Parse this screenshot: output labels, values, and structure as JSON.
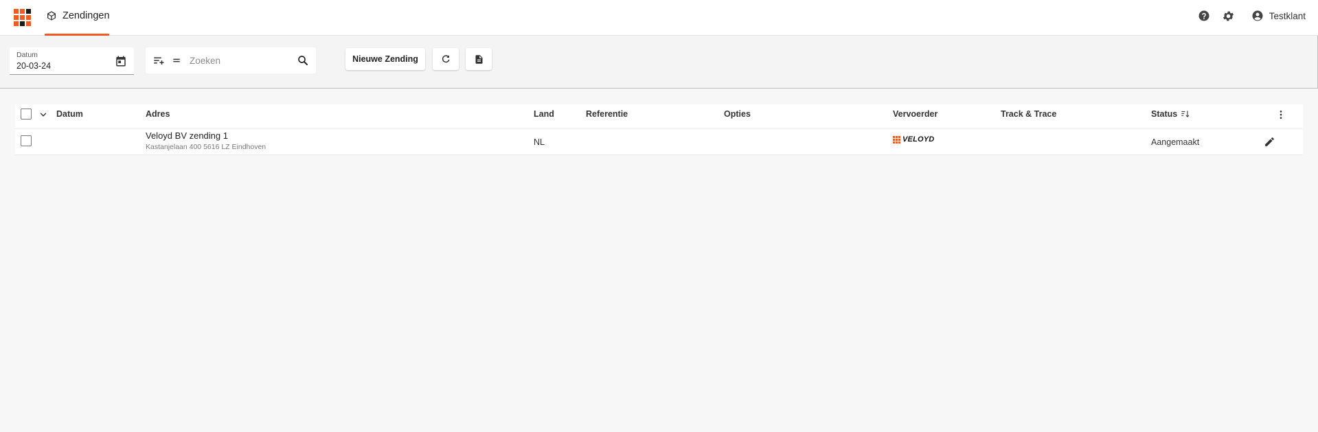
{
  "app": {
    "logo_colors": [
      "#f15a22",
      "#f15a22",
      "#1a1a1a",
      "#f15a22",
      "#f15a22",
      "#f15a22",
      "#f15a22",
      "#1a1a1a",
      "#f15a22"
    ],
    "accent": "#f15a22"
  },
  "header": {
    "tab_label": "Zendingen",
    "tab_icon": "package-icon",
    "help_icon": "help-circle-icon",
    "settings_icon": "gear-icon",
    "user_icon": "account-circle-icon",
    "user_label": "Testklant"
  },
  "toolbar": {
    "date_label": "Datum",
    "date_value": "20-03-24",
    "search_placeholder": "Zoeken",
    "new_label": "Nieuwe Zending",
    "refresh_icon": "refresh-icon",
    "export_icon": "file-document-icon"
  },
  "table": {
    "columns": {
      "datum": "Datum",
      "adres": "Adres",
      "land": "Land",
      "referentie": "Referentie",
      "opties": "Opties",
      "vervoerder": "Vervoerder",
      "track": "Track & Trace",
      "status": "Status"
    },
    "rows": [
      {
        "datum": "",
        "adres": "Veloyd BV zending 1",
        "adres_sub": "Kastanjelaan 400 5616 LZ Eindhoven",
        "land": "NL",
        "referentie": "",
        "opties": "",
        "vervoerder": "VELOYD",
        "track": "",
        "status": "Aangemaakt"
      }
    ]
  }
}
